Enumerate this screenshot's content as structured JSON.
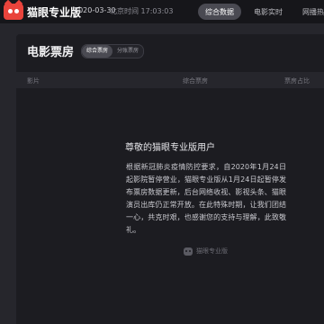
{
  "header": {
    "brand": "猫眼专业版",
    "date": "2020-03-30",
    "beijing_time": "北京时间 17:03:03",
    "tabs": [
      {
        "label": "综合数据"
      },
      {
        "label": "电影实时"
      },
      {
        "label": "网播热度"
      }
    ]
  },
  "card": {
    "title": "电影票房",
    "toggle": {
      "options": [
        "综合票房",
        "分账票房"
      ]
    },
    "columns": [
      "影片",
      "综合票房",
      "票房占比"
    ]
  },
  "notice": {
    "title": "尊敬的猫眼专业版用户",
    "body": "根据新冠肺炎疫情防控要求，自2020年1月24日起影院暂停营业，猫眼专业版从1月24日起暂停发布票房数据更新，后台网络收视、影视头条、猫眼演员出库仍正常开放。在此特殊时期，让我们团结一心，共克时艰，也感谢您的支持与理解，此致敬礼。",
    "footer": "猫眼专业版"
  },
  "colors": {
    "brand_red": "#e9443c",
    "topbar_bg": "#16161a",
    "card_bg": "#1c1c21",
    "page_bg": "#26262c"
  }
}
